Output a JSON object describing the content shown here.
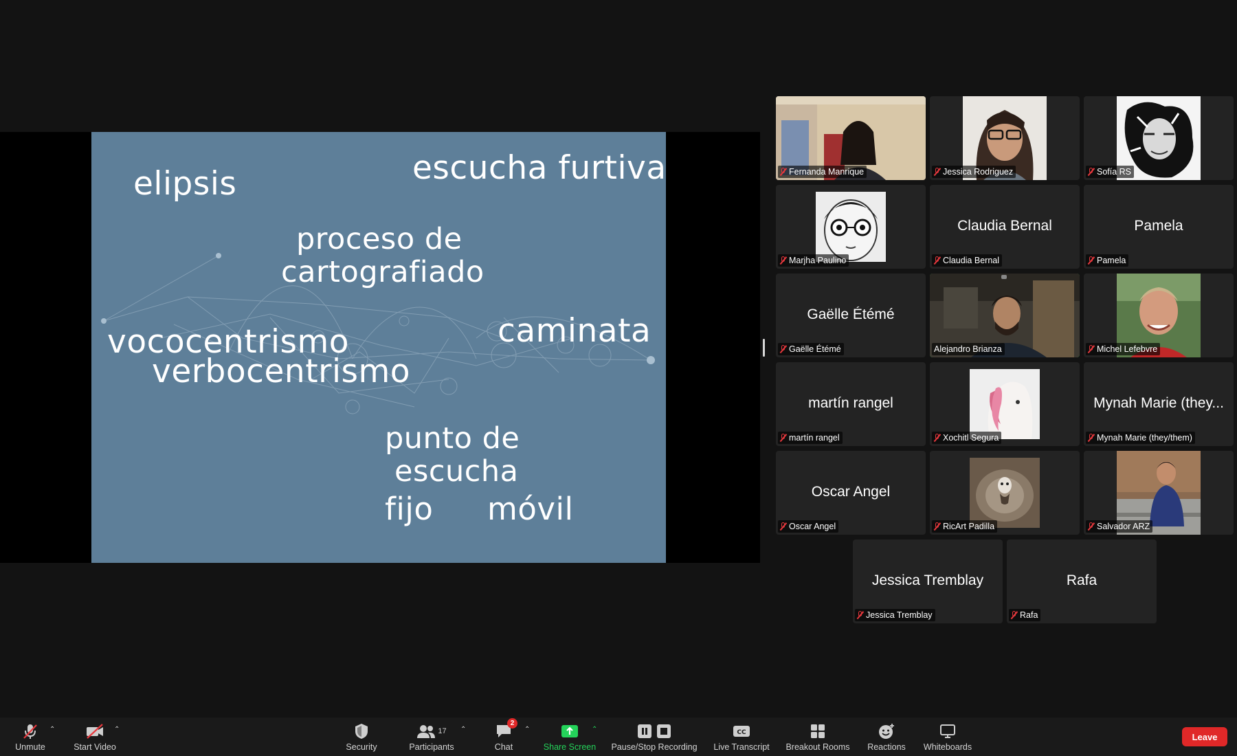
{
  "slide": {
    "words": {
      "elipsis": "elipsis",
      "escucha_furtiva": "escucha furtiva",
      "proceso_line1": "proceso de",
      "proceso_line2": "cartografiado",
      "vococentrismo": "vococentrismo",
      "verbocentrismo": "verbocentrismo",
      "caminata": "caminata",
      "punto_line1": "punto de",
      "punto_line2": "escucha",
      "fijo": "fijo",
      "movil": "móvil"
    }
  },
  "participants": [
    {
      "name": "Fernanda Manrique",
      "video": "camera",
      "muted": true
    },
    {
      "name": "Jessica Rodriguez",
      "video": "photo",
      "muted": true
    },
    {
      "name": "Sofía RS",
      "video": "photo",
      "muted": true
    },
    {
      "name": "Marjha Paulino",
      "video": "photo",
      "muted": true
    },
    {
      "name": "Claudia Bernal",
      "display": "Claudia Bernal",
      "video": "none",
      "muted": true
    },
    {
      "name": "Pamela",
      "display": "Pamela",
      "video": "none",
      "muted": true
    },
    {
      "name": "Gaëlle Étémé",
      "display": "Gaëlle Étémé",
      "video": "none",
      "muted": true
    },
    {
      "name": "Alejandro Brianza",
      "video": "camera",
      "muted": false,
      "active_speaker": true
    },
    {
      "name": "Michel Lefebvre",
      "video": "photo",
      "muted": true
    },
    {
      "name": "martín rangel",
      "display": "martín rangel",
      "video": "none",
      "muted": true
    },
    {
      "name": "Xochitl Segura",
      "video": "photo",
      "muted": true
    },
    {
      "name": "Mynah Marie (they/them)",
      "display": "Mynah Marie (they...",
      "video": "none",
      "muted": true
    },
    {
      "name": "Oscar Angel",
      "display": "Oscar Angel",
      "video": "none",
      "muted": true
    },
    {
      "name": "RicArt Padilla",
      "video": "photo",
      "muted": true
    },
    {
      "name": "Salvador ARZ",
      "video": "photo",
      "muted": true
    },
    {
      "name": "Jessica Tremblay",
      "display": "Jessica Tremblay",
      "video": "none",
      "muted": true
    },
    {
      "name": "Rafa",
      "display": "Rafa",
      "video": "none",
      "muted": true
    }
  ],
  "toolbar": {
    "unmute": "Unmute",
    "start_video": "Start Video",
    "security": "Security",
    "participants": "Participants",
    "participants_count": "17",
    "chat": "Chat",
    "chat_badge": "2",
    "share_screen": "Share Screen",
    "recording": "Pause/Stop Recording",
    "live_transcript": "Live Transcript",
    "breakout_rooms": "Breakout Rooms",
    "reactions": "Reactions",
    "whiteboards": "Whiteboards",
    "leave": "Leave"
  },
  "colors": {
    "background": "#131313",
    "slide": "#5e7f99",
    "active_speaker": "#23d959",
    "leave": "#e02828",
    "share_green": "#24d35a",
    "muted_red": "#e8383d"
  }
}
